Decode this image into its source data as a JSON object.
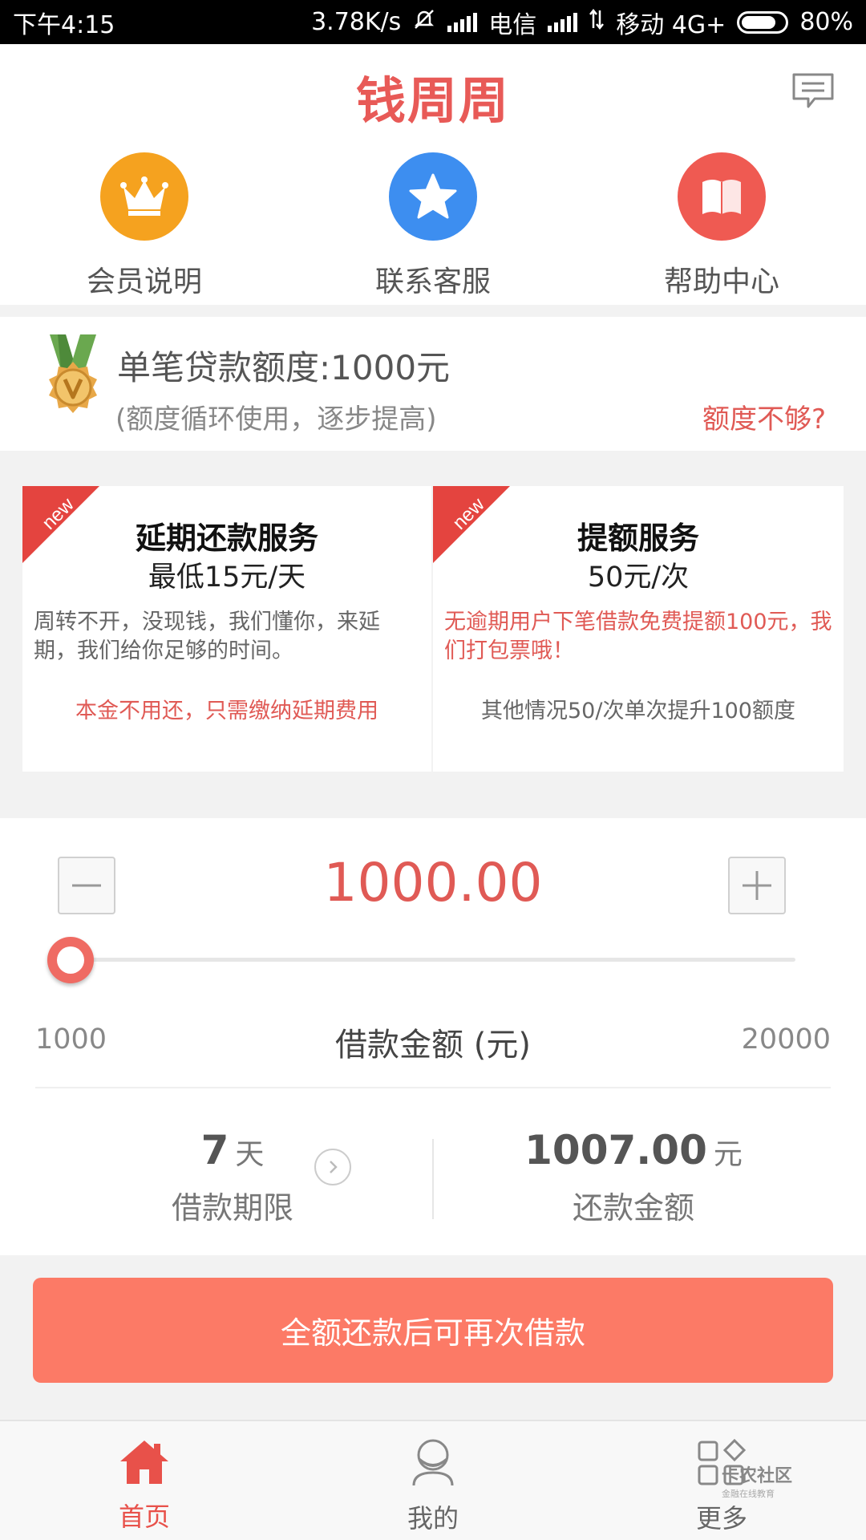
{
  "status_bar": {
    "time": "下午4:15",
    "speed": "3.78K/s",
    "carrier1": "电信",
    "carrier2": "移动 4G+",
    "battery": "80%",
    "battery_level": 0.8
  },
  "header": {
    "logo": "钱周周",
    "message_icon": "message-icon"
  },
  "quick_menu": [
    {
      "label": "会员说明",
      "icon": "crown-icon",
      "color": "#f5a21f"
    },
    {
      "label": "联系客服",
      "icon": "star-icon",
      "color": "#3d8ef0"
    },
    {
      "label": "帮助中心",
      "icon": "book-icon",
      "color": "#ef5a52"
    }
  ],
  "credit": {
    "limit_text": "单笔贷款额度:1000元",
    "sub_text": "(额度循环使用，逐步提高)",
    "more_link": "额度不够?"
  },
  "cards": [
    {
      "badge": "new",
      "title": "延期还款服务",
      "price": "最低15元/天",
      "desc": "周转不开，没现钱，我们懂你，来延期，我们给你足够的时间。",
      "note": "本金不用还，只需缴纳延期费用"
    },
    {
      "badge": "new",
      "title": "提额服务",
      "price": "50元/次",
      "desc": "无逾期用户下笔借款免费提额100元，我们打包票哦！",
      "note": "其他情况50/次单次提升100额度"
    }
  ],
  "loan": {
    "amount": "1000.00",
    "min": "1000",
    "max": "20000",
    "amount_label": "借款金额 (元)",
    "slider_value": 1000,
    "term_value": "7",
    "term_unit": "天",
    "term_label": "借款期限",
    "repay_value": "1007.00",
    "repay_unit": "元",
    "repay_label": "还款金额"
  },
  "action_button": "全额还款后可再次借款",
  "bottom_nav": [
    {
      "label": "首页",
      "icon": "home-icon",
      "active": true
    },
    {
      "label": "我的",
      "icon": "user-icon",
      "active": false
    },
    {
      "label": "更多",
      "icon": "grid-icon",
      "active": false
    }
  ],
  "watermark": {
    "line1": "卡农社区",
    "line2": "金融在线教育"
  },
  "colors": {
    "brand": "#e85a57",
    "button": "#fc7a66",
    "accent_red": "#e05a55"
  }
}
